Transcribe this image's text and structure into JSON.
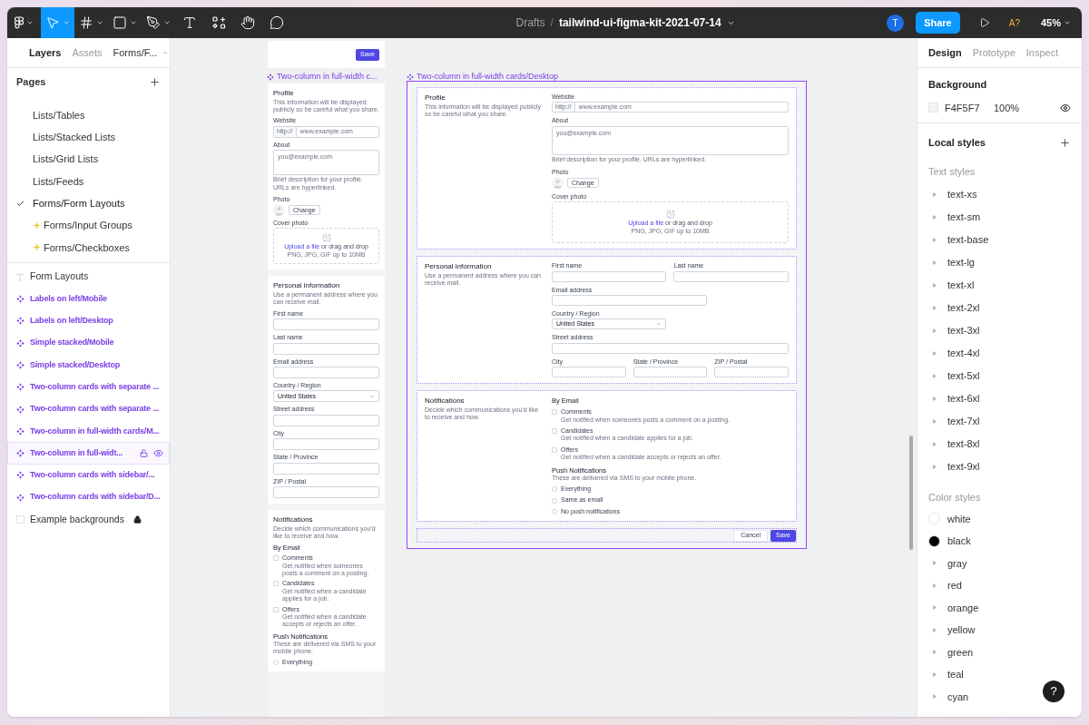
{
  "toolbar": {
    "tools": [
      {
        "kind": "main-menu",
        "selected": false,
        "menu": true
      },
      {
        "kind": "move",
        "selected": true,
        "menu": true
      },
      {
        "kind": "frame",
        "selected": false,
        "menu": true
      },
      {
        "kind": "shape",
        "selected": false,
        "menu": true
      },
      {
        "kind": "pen",
        "selected": false,
        "menu": true
      },
      {
        "kind": "text",
        "selected": false,
        "menu": false
      },
      {
        "kind": "resources",
        "selected": false,
        "menu": false
      },
      {
        "kind": "hand",
        "selected": false,
        "menu": false
      },
      {
        "kind": "comment",
        "selected": false,
        "menu": false
      }
    ],
    "folder": "Drafts",
    "separator": "/",
    "file_name": "tailwind-ui-figma-kit-2021-07-14",
    "user_initial": "T",
    "share": "Share",
    "font_warning": "A?",
    "zoom": "45%"
  },
  "left_panel": {
    "tabs": [
      {
        "label": "Layers",
        "selected": true
      },
      {
        "label": "Assets",
        "selected": false
      }
    ],
    "page_picker": "Forms/F...",
    "pages_title": "Pages",
    "pages": [
      {
        "label": "Lists/Tables",
        "kind": "plain",
        "current": false
      },
      {
        "label": "Lists/Stacked Lists",
        "kind": "plain",
        "current": false
      },
      {
        "label": "Lists/Grid Lists",
        "kind": "plain",
        "current": false
      },
      {
        "label": "Lists/Feeds",
        "kind": "plain",
        "current": false
      },
      {
        "label": "Forms/Form Layouts",
        "kind": "plain",
        "current": true
      },
      {
        "label": "Forms/Input Groups",
        "kind": "sparkle",
        "current": false
      },
      {
        "label": "Forms/Checkboxes",
        "kind": "sparkle",
        "current": false
      }
    ],
    "layers": [
      {
        "kind": "text",
        "name": "Form Layouts",
        "selected": false,
        "locked": false
      },
      {
        "kind": "component",
        "name": "Labels on left/Mobile",
        "selected": false,
        "locked": false
      },
      {
        "kind": "component",
        "name": "Labels on left/Desktop",
        "selected": false,
        "locked": false
      },
      {
        "kind": "component",
        "name": "Simple stacked/Mobile",
        "selected": false,
        "locked": false
      },
      {
        "kind": "component",
        "name": "Simple stacked/Desktop",
        "selected": false,
        "locked": false
      },
      {
        "kind": "component",
        "name": "Two-column cards with separate ...",
        "selected": false,
        "locked": false
      },
      {
        "kind": "component",
        "name": "Two-column cards with separate ...",
        "selected": false,
        "locked": false
      },
      {
        "kind": "component",
        "name": "Two-column in full-width cards/M...",
        "selected": false,
        "locked": false
      },
      {
        "kind": "component",
        "name": "Two-column in full-widt...",
        "selected": true,
        "locked": false
      },
      {
        "kind": "component",
        "name": "Two-column cards with sidebar/...",
        "selected": false,
        "locked": false
      },
      {
        "kind": "component",
        "name": "Two-column cards with sidebar/D...",
        "selected": false,
        "locked": false
      },
      {
        "kind": "frame",
        "name": "Example backgrounds",
        "selected": false,
        "locked": true
      }
    ]
  },
  "canvas": {
    "mobile": {
      "save": "Save",
      "title": "Two-column in full-width c...",
      "sections": [
        {
          "title": "Profile",
          "description": "This information will be displayed publicly so be careful what you share.",
          "fields": [
            {
              "kind": "prefixed",
              "label": "Website",
              "prefix": "http://",
              "placeholder": "www.example.com"
            },
            {
              "kind": "textarea",
              "label": "About",
              "placeholder": "you@example.com",
              "help": "Brief description for your profile. URLs are hyperlinked."
            },
            {
              "kind": "photo",
              "label": "Photo",
              "button": "Change"
            },
            {
              "kind": "upload",
              "label": "Cover photo",
              "link": "Upload a file",
              "text": "or drag and drop",
              "hint": "PNG, JPG, GIF up to 10MB"
            }
          ]
        },
        {
          "title": "Personal information",
          "description": "Use a permanent address where you can receive mail.",
          "fields": [
            {
              "kind": "text",
              "label": "First name"
            },
            {
              "kind": "text",
              "label": "Last name"
            },
            {
              "kind": "text",
              "label": "Email address"
            },
            {
              "kind": "select",
              "label": "Country / Region",
              "value": "United States"
            },
            {
              "kind": "text",
              "label": "Street address"
            },
            {
              "kind": "text",
              "label": "City"
            },
            {
              "kind": "text",
              "label": "State / Province"
            },
            {
              "kind": "text",
              "label": "ZIP / Postal"
            }
          ]
        },
        {
          "title": "Notifications",
          "description": "Decide which communications you'd like to receive and how.",
          "fields": [
            {
              "kind": "checks",
              "title": "By Email",
              "items": [
                {
                  "label": "Comments",
                  "description": "Get notified when someones posts a comment on a posting.",
                  "checked": false
                },
                {
                  "label": "Candidates",
                  "description": "Get notified when a candidate applies for a job.",
                  "checked": false
                },
                {
                  "label": "Offers",
                  "description": "Get notified when a candidate accepts or rejects an offer.",
                  "checked": false
                }
              ]
            },
            {
              "kind": "radios",
              "title": "Push Notifications",
              "description": "These are delivered via SMS to your mobile phone.",
              "items": [
                {
                  "label": "Everything",
                  "selected": false
                }
              ]
            }
          ]
        }
      ]
    },
    "desktop": {
      "title": "Two-column in full-width cards/Desktop",
      "sections": [
        {
          "title": "Profile",
          "description": "This information will be displayed publicly so be careful what you share.",
          "fields": [
            {
              "kind": "prefixed",
              "label": "Website",
              "prefix": "http://",
              "placeholder": "www.example.com"
            },
            {
              "kind": "textarea",
              "label": "About",
              "placeholder": "you@example.com",
              "help": "Brief description for your profile. URLs are hyperlinked."
            },
            {
              "kind": "photo",
              "label": "Photo",
              "button": "Change"
            },
            {
              "kind": "upload",
              "label": "Cover photo",
              "link": "Upload a file",
              "text": "or drag and drop",
              "hint": "PNG, JPG, GIF up to 10MB"
            }
          ]
        },
        {
          "title": "Personal information",
          "description": "Use a permanent address where you can receive mail.",
          "fields": [
            {
              "kind": "text",
              "label": "First name"
            },
            {
              "kind": "text",
              "label": "Last name"
            },
            {
              "kind": "text",
              "label": "Email address"
            },
            {
              "kind": "select",
              "label": "Country / Region",
              "value": "United States"
            },
            {
              "kind": "text",
              "label": "Street address"
            },
            {
              "kind": "text",
              "label": "City"
            },
            {
              "kind": "text",
              "label": "State / Province"
            },
            {
              "kind": "text",
              "label": "ZIP / Postal"
            }
          ]
        },
        {
          "title": "Notifications",
          "description": "Decide which communications you'd like to receive and how.",
          "fields": [
            {
              "kind": "checks",
              "title": "By Email",
              "items": [
                {
                  "label": "Comments",
                  "description": "Get notified when someones posts a comment on a posting.",
                  "checked": false
                },
                {
                  "label": "Candidates",
                  "description": "Get notified when a candidate applies for a job.",
                  "checked": false
                },
                {
                  "label": "Offers",
                  "description": "Get notified when a candidate accepts or rejects an offer.",
                  "checked": false
                }
              ]
            },
            {
              "kind": "radios",
              "title": "Push Notifications",
              "description": "These are delivered via SMS to your mobile phone.",
              "items": [
                {
                  "label": "Everything",
                  "selected": false
                },
                {
                  "label": "Same as email",
                  "selected": false
                },
                {
                  "label": "No push notifications",
                  "selected": false
                }
              ]
            }
          ]
        }
      ],
      "cancel": "Cancel",
      "save": "Save"
    }
  },
  "right_panel": {
    "tabs": [
      {
        "label": "Design",
        "selected": true
      },
      {
        "label": "Prototype",
        "selected": false
      },
      {
        "label": "Inspect",
        "selected": false
      }
    ],
    "background": {
      "title": "Background",
      "color": "#f4f5f7",
      "hex": "F4F5F7",
      "opacity": "100%",
      "visible": true
    },
    "local_styles": "Local styles",
    "text_styles_title": "Text styles",
    "text_styles": [
      "text-xs",
      "text-sm",
      "text-base",
      "text-lg",
      "text-xl",
      "text-2xl",
      "text-3xl",
      "text-4xl",
      "text-5xl",
      "text-6xl",
      "text-7xl",
      "text-8xl",
      "text-9xl"
    ],
    "color_styles_title": "Color styles",
    "color_styles": [
      {
        "kind": "swatch",
        "name": "white",
        "color": "#ffffff"
      },
      {
        "kind": "swatch",
        "name": "black",
        "color": "#000000"
      },
      {
        "kind": "group",
        "name": "gray"
      },
      {
        "kind": "group",
        "name": "red"
      },
      {
        "kind": "group",
        "name": "orange"
      },
      {
        "kind": "group",
        "name": "yellow"
      },
      {
        "kind": "group",
        "name": "green"
      },
      {
        "kind": "group",
        "name": "teal"
      },
      {
        "kind": "group",
        "name": "cyan"
      }
    ],
    "help": "?"
  }
}
